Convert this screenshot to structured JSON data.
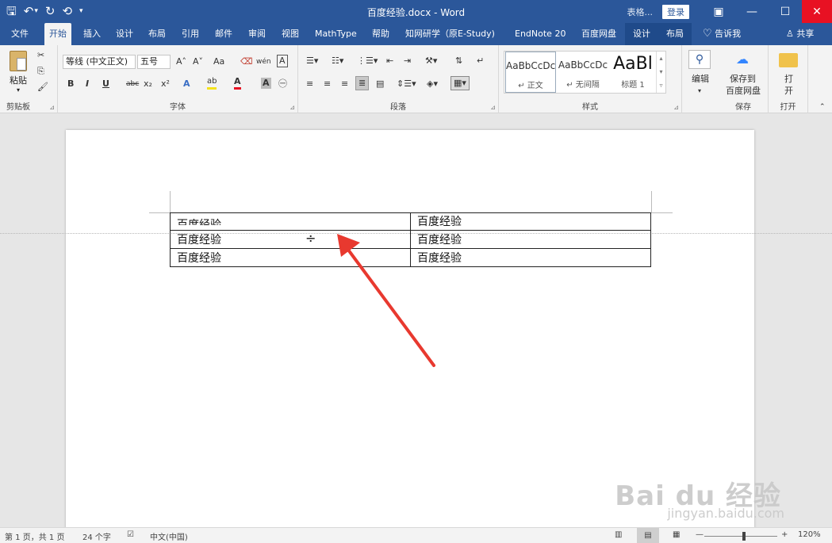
{
  "window": {
    "title": "百度经验.docx - Word",
    "context_label": "表格...",
    "login": "登录",
    "controls": {
      "ribbon_options": "▣",
      "minimize": "—",
      "maximize": "☐",
      "close": "✕"
    }
  },
  "qat": {
    "save": "🖫",
    "undo": "↶",
    "undo_dropdown": "▾",
    "redo": "↻",
    "refresh": "⟲",
    "customize": "▾"
  },
  "tabs": [
    {
      "label": "文件"
    },
    {
      "label": "开始"
    },
    {
      "label": "插入"
    },
    {
      "label": "设计"
    },
    {
      "label": "布局"
    },
    {
      "label": "引用"
    },
    {
      "label": "邮件"
    },
    {
      "label": "审阅"
    },
    {
      "label": "视图"
    },
    {
      "label": "MathType"
    },
    {
      "label": "帮助"
    },
    {
      "label": "知网研学（原E-Study)"
    },
    {
      "label": "EndNote 20"
    },
    {
      "label": "百度网盘"
    },
    {
      "label": "设计"
    },
    {
      "label": "布局"
    }
  ],
  "tellme": {
    "icon": "lightbulb-icon",
    "label": "告诉我"
  },
  "share": {
    "label": "共享"
  },
  "ribbon": {
    "clipboard": {
      "paste": "粘贴",
      "label": "剪贴板"
    },
    "font": {
      "font_name": "等线 (中文正文)",
      "font_size": "五号",
      "grow": "A˄",
      "shrink": "A˅",
      "change_case": "Aa",
      "clear": "⌫",
      "phonetic": "wén",
      "border_char": "A",
      "bold": "B",
      "italic": "I",
      "underline": "U",
      "strike": "abc",
      "subscript": "x₂",
      "superscript": "x²",
      "text_effect": "A",
      "highlight": "ab",
      "font_color": "A",
      "char_shading": "A",
      "enclose": "㊀",
      "label": "字体"
    },
    "paragraph": {
      "label": "段落"
    },
    "styles": {
      "items": [
        {
          "preview": "AaBbCcDc",
          "name": "↵ 正文"
        },
        {
          "preview": "AaBbCcDc",
          "name": "↵ 无间隔"
        },
        {
          "preview": "AaBl",
          "name": "标题 1"
        }
      ],
      "label": "样式"
    },
    "editing": {
      "label": "编辑"
    },
    "save": {
      "line1": "保存到",
      "line2": "百度网盘",
      "label": "保存"
    },
    "open": {
      "line1": "打",
      "line2": "开",
      "label": "打开"
    }
  },
  "document": {
    "table": [
      [
        "百度经验",
        "百度经验"
      ],
      [
        "百度经验",
        "百度经验"
      ],
      [
        "百度经验",
        "百度经验"
      ]
    ],
    "cursor": "÷"
  },
  "status": {
    "page": "第 1 页，共 1 页",
    "words": "24 个字",
    "language": "中文(中国)",
    "zoom_minus": "—",
    "zoom_plus": "+",
    "zoom": "120%"
  },
  "watermark": {
    "main": "Bai du 经验",
    "sub": "jingyan.baidu.com"
  },
  "colors": {
    "accent": "#2b579a",
    "close": "#e81123",
    "arrow": "#e8392f"
  }
}
